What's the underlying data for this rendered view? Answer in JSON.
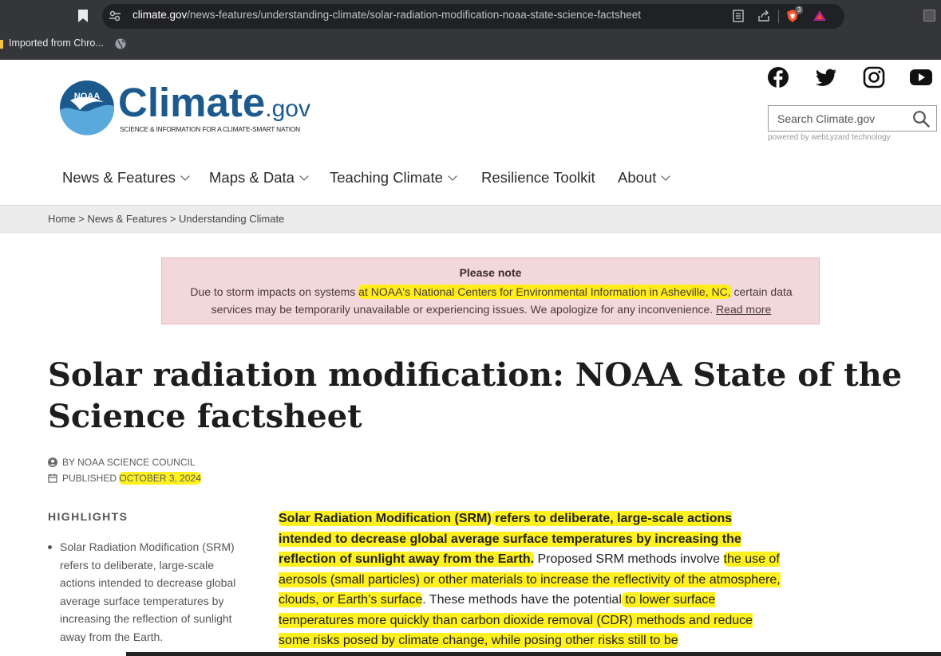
{
  "browser": {
    "url_host": "climate.gov",
    "url_path": "/news-features/understanding-climate/solar-radiation-modification-noaa-state-science-factsheet",
    "brave_badge_count": "3",
    "bookmarks_bar": {
      "folder_label": "Imported from Chro..."
    }
  },
  "site": {
    "logo_seal_text": "NOAA",
    "logo_word": "Climate",
    "logo_suffix": ".gov",
    "tagline": "SCIENCE & INFORMATION FOR A CLIMATE-SMART NATION",
    "search_placeholder": "Search Climate.gov",
    "powered_by": "powered by webLyzard technology",
    "social": [
      "facebook-icon",
      "twitter-icon",
      "instagram-icon",
      "youtube-icon"
    ],
    "nav": [
      {
        "label": "News & Features",
        "dropdown": true
      },
      {
        "label": "Maps & Data",
        "dropdown": true
      },
      {
        "label": "Teaching Climate",
        "dropdown": true
      },
      {
        "label": "Resilience Toolkit",
        "dropdown": false
      },
      {
        "label": "About",
        "dropdown": true
      }
    ],
    "accent_color": "#1c5a8e"
  },
  "breadcrumb": {
    "home": "Home",
    "sep": " > ",
    "section": "News & Features",
    "subsection": "Understanding Climate"
  },
  "notice": {
    "title": "Please note",
    "text_before": "Due to storm impacts on systems ",
    "text_highlight": "at NOAA's National Centers for Environmental Information in Asheville, NC,",
    "text_after": " certain data services may be temporarily unavailable or experiencing issues. We apologize for any inconvenience. ",
    "link": "Read more",
    "background_color": "#f2d8da"
  },
  "article": {
    "title": "Solar radiation modification: NOAA State of the Science factsheet",
    "author": "BY NOAA SCIENCE COUNCIL",
    "published_label": "PUBLISHED",
    "published_date": "OCTOBER 3, 2024",
    "highlights_heading": "HIGHLIGHTS",
    "highlights": [
      "Solar Radiation Modification (SRM) refers to deliberate, large-scale actions intended to decrease global average surface temperatures by increasing the reflection of sunlight away from the Earth."
    ],
    "body": {
      "bold_1": "Solar Radiation Modification (SRM)",
      "bold_2": " refers to deliberate, large-scale actions intended to decrease global average surface temperatures by increasing the reflection of sunlight away from the Earth.",
      "plain_1": " Proposed SRM methods involve ",
      "hl_1": "the use of aerosols (small particles) or other materials to increase the reflectivity of the atmosphere, clouds, or Earth’s surface",
      "plain_2": ". These methods have the potentia",
      "plain_3": "l",
      "hl_2": " to lower surface temperatures more quickly than carbon dioxide removal (CDR) methods and reduce some risks posed by climate change, while posing other risks still to be"
    },
    "highlight_color": "#ffef00"
  }
}
